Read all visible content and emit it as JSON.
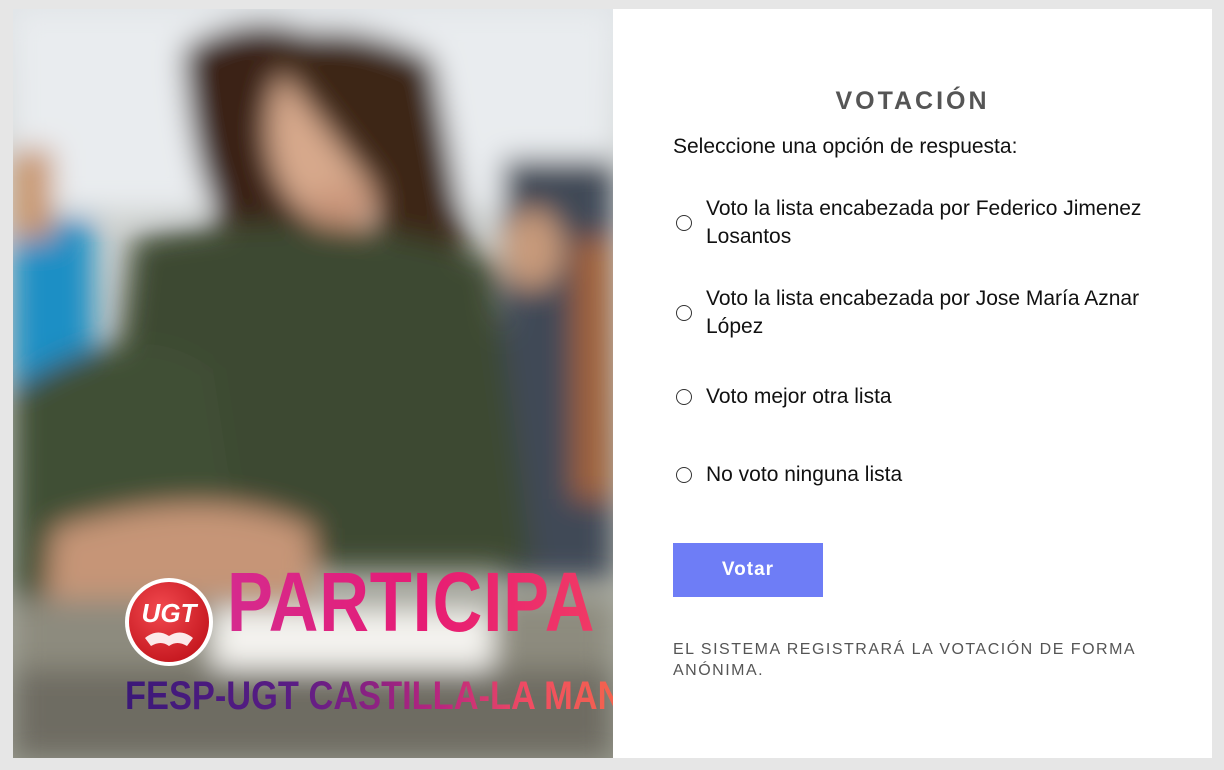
{
  "hero": {
    "logo_text": "UGT",
    "headline": "PARTICIPA",
    "subheadline": "FESP-UGT CASTILLA-LA MANCHA"
  },
  "form": {
    "title": "VOTACIÓN",
    "prompt": "Seleccione una opción de respuesta:",
    "options": [
      {
        "label": "Voto la lista encabezada por Federico Jimenez Losantos",
        "selected": false
      },
      {
        "label": "Voto la lista encabezada por Jose María Aznar López",
        "selected": false
      },
      {
        "label": "Voto mejor otra lista",
        "selected": false
      },
      {
        "label": "No voto ninguna lista",
        "selected": false
      }
    ],
    "submit_label": "Votar",
    "notice": "EL SISTEMA REGISTRARÁ LA VOTACIÓN DE FORMA ANÓNIMA."
  },
  "colors": {
    "button": "#6e7df6",
    "title": "#555555",
    "headline_pink": "#e71c74",
    "subheadline_purple": "#3b1878",
    "subheadline_orange": "#f47a3a",
    "logo_red": "#e3262e"
  }
}
